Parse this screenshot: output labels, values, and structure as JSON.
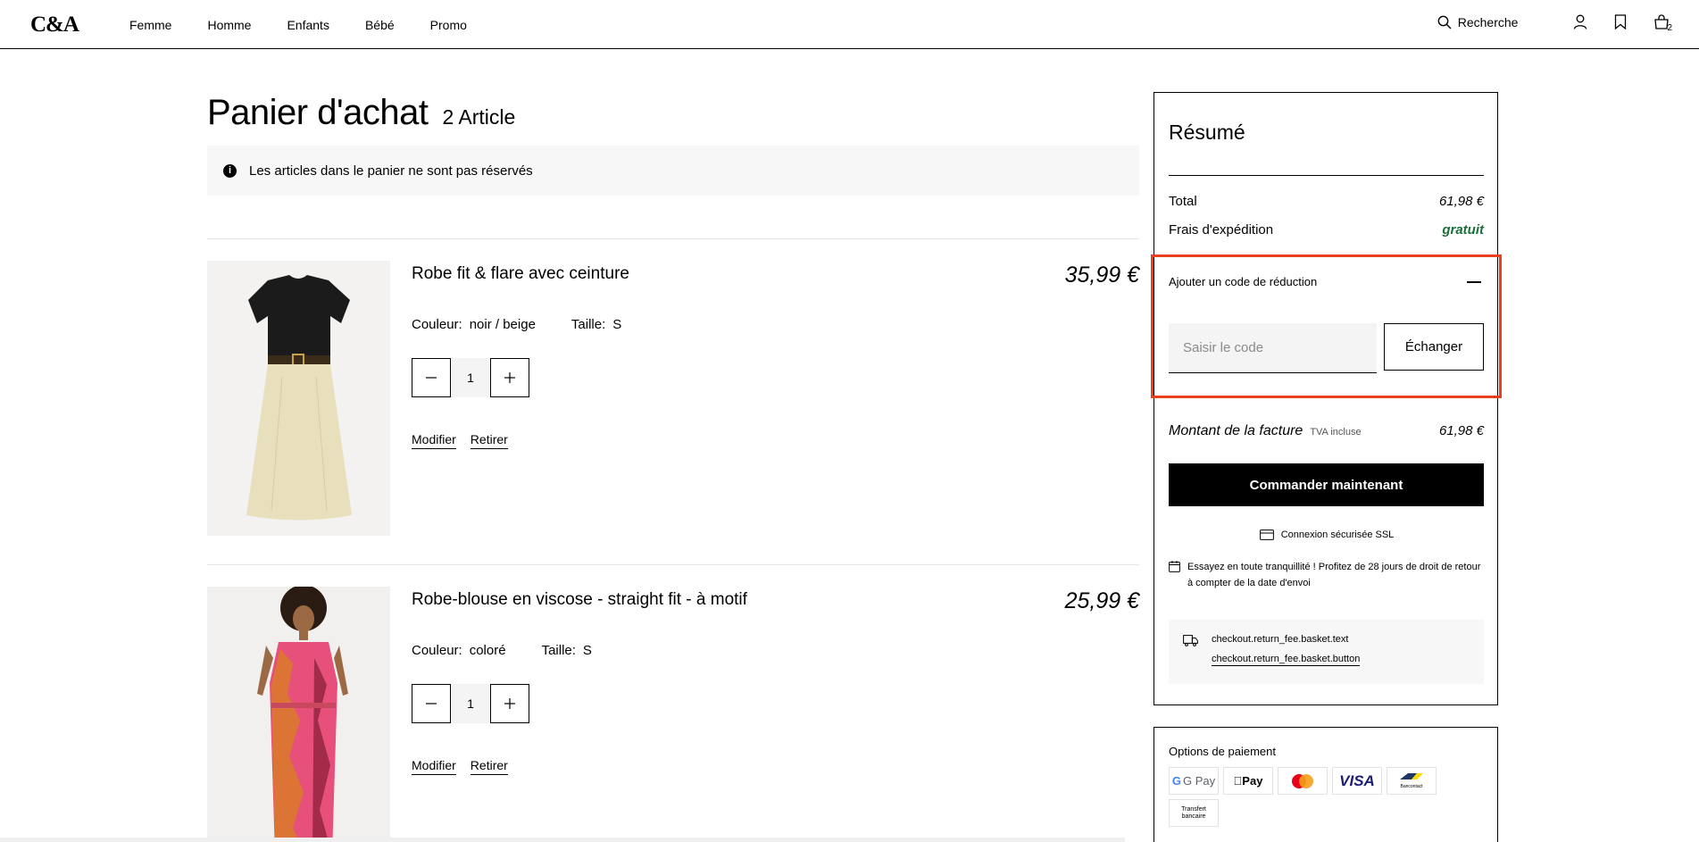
{
  "header": {
    "logo": "C&A",
    "nav": [
      "Femme",
      "Homme",
      "Enfants",
      "Bébé",
      "Promo"
    ],
    "search_label": "Recherche",
    "cart_count": "2"
  },
  "page": {
    "title": "Panier d'achat",
    "count": "2 Article",
    "info": "Les articles dans le panier ne sont pas réservés"
  },
  "items": [
    {
      "name": "Robe fit & flare avec ceinture",
      "price": "35,99 €",
      "color_label": "Couleur:",
      "color": "noir / beige",
      "size_label": "Taille:",
      "size": "S",
      "qty": "1",
      "modify": "Modifier",
      "remove": "Retirer"
    },
    {
      "name": "Robe-blouse en viscose - straight fit - à motif",
      "price": "25,99 €",
      "color_label": "Couleur:",
      "color": "coloré",
      "size_label": "Taille:",
      "size": "S",
      "qty": "1",
      "modify": "Modifier",
      "remove": "Retirer"
    }
  ],
  "summary": {
    "title": "Résumé",
    "total_label": "Total",
    "total_value": "61,98 €",
    "shipping_label": "Frais d'expédition",
    "shipping_value": "gratuit",
    "discount_title": "Ajouter un code de réduction",
    "discount_placeholder": "Saisir le code",
    "discount_button": "Échanger",
    "invoice_label": "Montant de la facture",
    "invoice_tva": "TVA incluse",
    "invoice_value": "61,98 €",
    "order_button": "Commander maintenant",
    "ssl": "Connexion sécurisée SSL",
    "trial": "Essayez en toute tranquillité ! Profitez de 28 jours de droit de retour à compter de la date d'envoi",
    "return_text": "checkout.return_fee.basket.text",
    "return_button": "checkout.return_fee.basket.button"
  },
  "payment": {
    "title": "Options de paiement",
    "methods": [
      "G Pay",
      "Pay",
      "",
      "VISA",
      "Bancontact",
      "Transfert bancaire"
    ]
  },
  "colors": {
    "highlight": "#e8401c",
    "free_shipping": "#1a6e3a",
    "order_button": "#000000"
  }
}
